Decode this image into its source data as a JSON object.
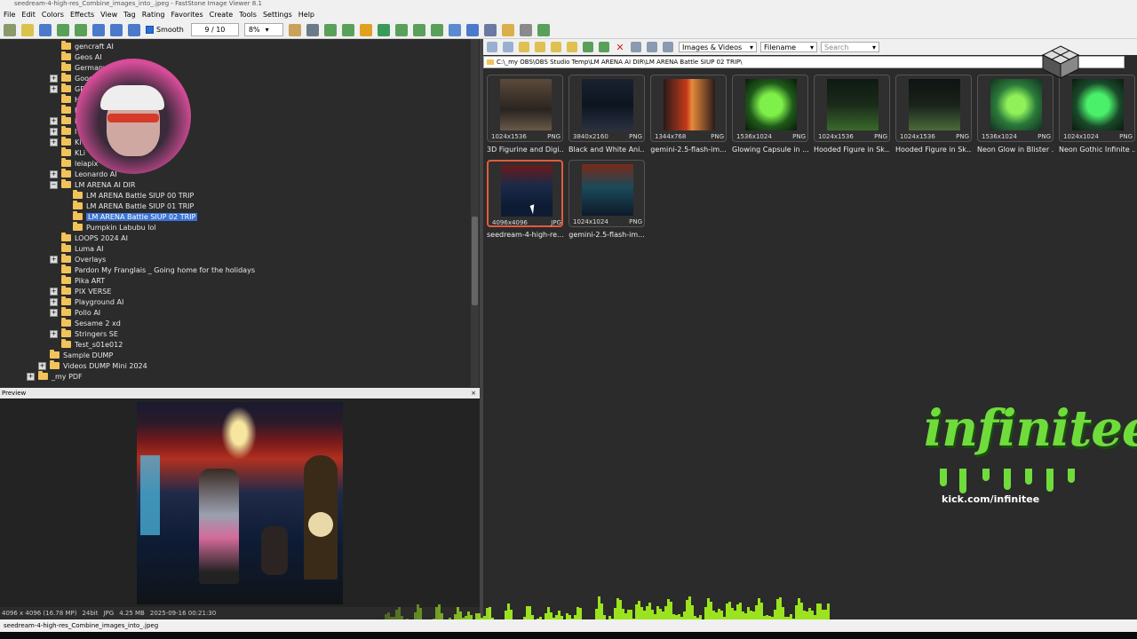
{
  "window": {
    "title": "seedream-4-high-res_Combine_images_into_.jpeg - FastStone Image Viewer 8.1"
  },
  "menu": [
    "File",
    "Edit",
    "Colors",
    "Effects",
    "View",
    "Tag",
    "Rating",
    "Favorites",
    "Create",
    "Tools",
    "Settings",
    "Help"
  ],
  "toolbar": {
    "smooth_label": "Smooth",
    "page_counter": "9 / 10",
    "zoom": "8%"
  },
  "tree": [
    {
      "label": "gencraft AI",
      "level": 2,
      "expander": false
    },
    {
      "label": "Geos AI",
      "level": 2,
      "expander": false
    },
    {
      "label": "Germany",
      "level": 2,
      "expander": false
    },
    {
      "label": "Goog",
      "level": 2,
      "expander": true
    },
    {
      "label": "GP",
      "level": 2,
      "expander": true
    },
    {
      "label": "H",
      "level": 2,
      "expander": false
    },
    {
      "label": "I",
      "level": 2,
      "expander": false
    },
    {
      "label": "I",
      "level": 2,
      "expander": true
    },
    {
      "label": "I",
      "level": 2,
      "expander": true
    },
    {
      "label": "Ki",
      "level": 2,
      "expander": true
    },
    {
      "label": "KLi",
      "level": 2,
      "expander": false
    },
    {
      "label": "leiapix",
      "level": 2,
      "expander": false
    },
    {
      "label": "Leonardo AI",
      "level": 2,
      "expander": true
    },
    {
      "label": "LM ARENA AI DIR",
      "level": 2,
      "expander": true,
      "open": true
    },
    {
      "label": "LM ARENA Battle SIUP 00 TRIP",
      "level": 3,
      "expander": false
    },
    {
      "label": "LM ARENA Battle SIUP 01 TRIP",
      "level": 3,
      "expander": false
    },
    {
      "label": "LM ARENA Battle SIUP 02 TRIP",
      "level": 3,
      "expander": false,
      "selected": true
    },
    {
      "label": "Pumpkin Labubu lol",
      "level": 3,
      "expander": false
    },
    {
      "label": "LOOPS 2024 AI",
      "level": 2,
      "expander": false
    },
    {
      "label": "Luma AI",
      "level": 2,
      "expander": false
    },
    {
      "label": "Overlays",
      "level": 2,
      "expander": true
    },
    {
      "label": "Pardon My Franglais _ Going home for the holidays",
      "level": 2,
      "expander": false
    },
    {
      "label": "Pika ART",
      "level": 2,
      "expander": false
    },
    {
      "label": "PIX VERSE",
      "level": 2,
      "expander": true
    },
    {
      "label": "Playground AI",
      "level": 2,
      "expander": true
    },
    {
      "label": "Pollo AI",
      "level": 2,
      "expander": true
    },
    {
      "label": "Sesame 2 xd",
      "level": 2,
      "expander": false
    },
    {
      "label": "Stringers SE",
      "level": 2,
      "expander": true
    },
    {
      "label": "Test_s01e012",
      "level": 2,
      "expander": false
    },
    {
      "label": "Sample DUMP",
      "level": 1,
      "expander": false
    },
    {
      "label": "Videos DUMP Mini 2024",
      "level": 1,
      "expander": true
    },
    {
      "label": "_my PDF",
      "level": 0,
      "expander": true
    }
  ],
  "preview": {
    "label": "Preview",
    "close": "×"
  },
  "image_status": {
    "dimensions": "4096 x 4096 (16.78 MP)",
    "bit": "24bit",
    "format": "JPG",
    "size": "4.25 MB",
    "date": "2025-09-16 00:21:30"
  },
  "bottom_status": "seedream-4-high-res_Combine_images_into_.jpeg",
  "browser": {
    "filter": "Images & Videos",
    "sort": "Filename",
    "search_placeholder": "Search",
    "path": "C:\\_my OBS\\OBS Studio Temp\\LM ARENA AI DIR\\LM ARENA Battle SIUP 02 TRIP\\"
  },
  "thumbnails": [
    {
      "dims": "1024x1536",
      "fmt": "PNG",
      "name": "3D Figurine and Digi...",
      "color": "linear-gradient(180deg,#5a4a3a,#2a2420 60%,#6a5a48)"
    },
    {
      "dims": "3840x2160",
      "fmt": "PNG",
      "name": "Black and White Ani...",
      "color": "linear-gradient(180deg,#1a2230,#0d1520 50%,#2a3040)"
    },
    {
      "dims": "1344x768",
      "fmt": "PNG",
      "name": "gemini-2.5-flash-im...",
      "color": "linear-gradient(90deg,#2a1a1a,#c63a1a 45%,#e88a3a 55%,#2a1a1a)"
    },
    {
      "dims": "1536x1024",
      "fmt": "PNG",
      "name": "Glowing Capsule in ...",
      "color": "radial-gradient(ellipse,#7ff04a 0 30%,#1f5a1a 60%,#0a1a0a)"
    },
    {
      "dims": "1024x1536",
      "fmt": "PNG",
      "name": "Hooded Figure in Sk...",
      "color": "linear-gradient(180deg,#0e1a12,#1a2a1a 50%,#3a6a2a)"
    },
    {
      "dims": "1024x1536",
      "fmt": "PNG",
      "name": "Hooded Figure in Sk...",
      "color": "linear-gradient(180deg,#0e1412,#1a221a 50%,#4a6a3a)"
    },
    {
      "dims": "1536x1024",
      "fmt": "PNG",
      "name": "Neon Glow in Blister ...",
      "color": "radial-gradient(ellipse,#8ff05a 0 25%,#2a7a3a 55%,#123020)"
    },
    {
      "dims": "1024x1024",
      "fmt": "PNG",
      "name": "Neon Gothic Infinite ...",
      "color": "radial-gradient(circle,#4af06a 0 30%,#1a4a2a 60%,#0a1a10)"
    },
    {
      "dims": "4096x4096",
      "fmt": "JPG",
      "name": "seedream-4-high-re...",
      "color": "linear-gradient(180deg,#6a1a1a,#1a2a48 40%,#0d1b33 80%)",
      "selected": true
    },
    {
      "dims": "1024x1024",
      "fmt": "PNG",
      "name": "gemini-2.5-flash-im...",
      "color": "linear-gradient(180deg,#7a2a1a,#1a4a5a 45%,#0e1a2a)"
    }
  ],
  "overlay": {
    "brand": "infinitee",
    "url": "kick.com/infinitee"
  }
}
